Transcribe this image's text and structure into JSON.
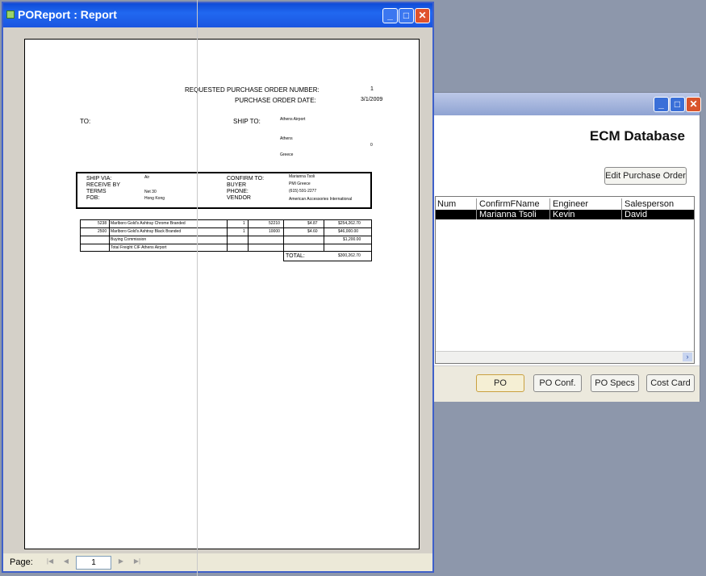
{
  "ecm_window": {
    "heading": "ECM Database",
    "edit_button": "Edit Purchase Order",
    "grid": {
      "headers": [
        "Num",
        "ConfirmFName",
        "Engineer",
        "Salesperson"
      ],
      "row": [
        "",
        "Marianna Tsoli",
        "Kevin",
        "David"
      ]
    },
    "buttons": [
      "PO",
      "PO Conf.",
      "PO Specs",
      "Cost Card"
    ]
  },
  "po_window": {
    "title": "POReport : Report",
    "page_label": "Page:",
    "page_number": "1",
    "report": {
      "req_po_label": "REQUESTED PURCHASE ORDER NUMBER:",
      "req_po_value": "1",
      "po_date_label": "PURCHASE ORDER DATE:",
      "po_date_value": "3/1/2009",
      "to_label": "TO:",
      "ship_to_label": "SHIP TO:",
      "ship_to_lines": [
        "Athens Airport",
        "Athens",
        "Greece"
      ],
      "ship_to_zero": "0",
      "info_left_labels": [
        "SHIP VIA:",
        "RECEIVE BY",
        "TERMS",
        "FOB:"
      ],
      "info_left_values": [
        "Air",
        "",
        "Net 30",
        "Hong Kong"
      ],
      "info_right_labels": [
        "CONFIRM TO:",
        "BUYER",
        "PHONE:",
        "VENDOR"
      ],
      "info_right_values": [
        "Marianna Tsoli",
        "PMI Greece",
        "(615) 591-2277",
        "American Accessories International"
      ],
      "items": [
        {
          "qty": "5238",
          "desc": "Marlboro Gold's Ashtray Chrome Branded",
          "a": "1",
          "b": "52210",
          "price": "$4.87",
          "total": "$254,262.70"
        },
        {
          "qty": "2500",
          "desc": "Marlboro Gold's Ashtray Black Branded",
          "a": "1",
          "b": "10000",
          "price": "$4.60",
          "total": "$46,000.00"
        },
        {
          "qty": "",
          "desc": "Buying Commission",
          "a": "",
          "b": "",
          "price": "",
          "total": "$1,200.00"
        },
        {
          "qty": "",
          "desc": "Total Freight CIF Athens Airport",
          "a": "",
          "b": "",
          "price": "",
          "total": ""
        }
      ],
      "total_label": "TOTAL:",
      "total_value": "$300,262.70"
    }
  }
}
